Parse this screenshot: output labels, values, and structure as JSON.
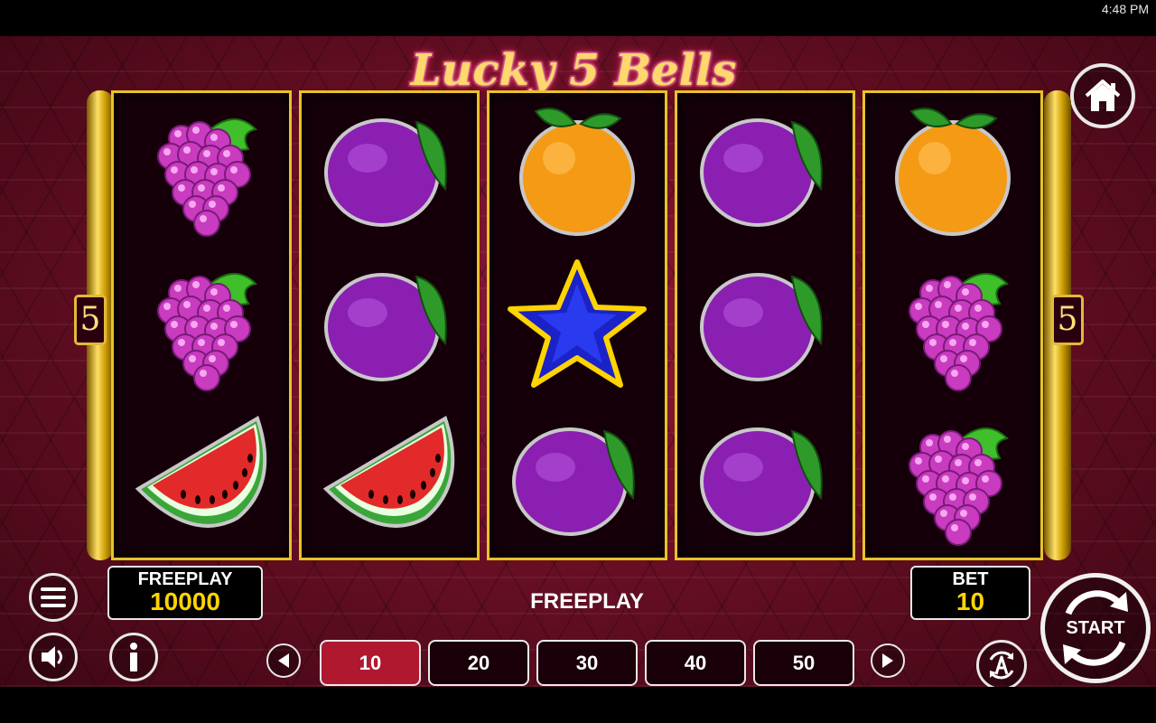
{
  "status_bar": {
    "time": "4:48 PM"
  },
  "game": {
    "title": "Lucky 5 Bells",
    "side_marker": "5"
  },
  "reels": [
    [
      "grapes-icon",
      "grapes-icon",
      "watermelon-icon"
    ],
    [
      "plum-icon",
      "plum-icon",
      "watermelon-icon"
    ],
    [
      "orange-icon",
      "star-icon",
      "plum-icon"
    ],
    [
      "plum-icon",
      "plum-icon",
      "plum-icon"
    ],
    [
      "orange-icon",
      "grapes-icon",
      "grapes-icon"
    ]
  ],
  "balance": {
    "label": "FREEPLAY",
    "value": "10000"
  },
  "mode": {
    "text": "FREEPLAY"
  },
  "bet": {
    "label": "BET",
    "value": "10"
  },
  "bet_options": [
    "10",
    "20",
    "30",
    "40",
    "50"
  ],
  "selected_bet": "10",
  "start": {
    "label": "START"
  },
  "colors": {
    "accent_gold": "#e8c22a",
    "selected_bet": "#b01830",
    "value_yellow": "#ffd400"
  }
}
